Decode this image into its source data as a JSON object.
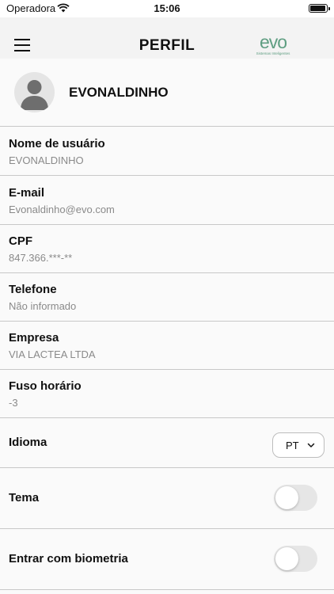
{
  "status_bar": {
    "carrier": "Operadora",
    "time": "15:06",
    "icons": [
      "wifi-icon",
      "battery-icon"
    ]
  },
  "header": {
    "title": "PERFIL",
    "brand_name": "evo",
    "brand_tagline": "Sistemas Inteligentes",
    "menu_icon": "hamburger-menu-icon"
  },
  "profile": {
    "display_name": "EVONALDINHO",
    "avatar_icon": "user-avatar-icon"
  },
  "fields": [
    {
      "label": "Nome de usuário",
      "value": "EVONALDINHO"
    },
    {
      "label": "E-mail",
      "value": "Evonaldinho@evo.com"
    },
    {
      "label": "CPF",
      "value": "847.366.***-**"
    },
    {
      "label": "Telefone",
      "value": "Não informado"
    },
    {
      "label": "Empresa",
      "value": "VIA LACTEA LTDA"
    },
    {
      "label": "Fuso horário",
      "value": "-3"
    }
  ],
  "language": {
    "label": "Idioma",
    "selected": "PT"
  },
  "theme": {
    "label": "Tema",
    "enabled": false
  },
  "biometrics": {
    "label": "Entrar com biometria",
    "enabled": false
  },
  "colors": {
    "brand": "#5f9e82",
    "divider": "#c8c8c8",
    "header_bg": "#f3f3f3",
    "page_bg": "#fafafa"
  }
}
